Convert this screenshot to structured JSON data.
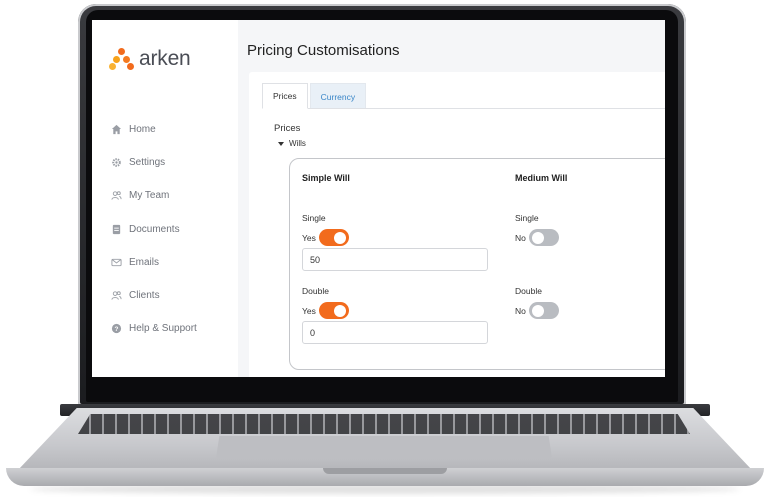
{
  "brand": {
    "name": "arken",
    "dot_colors": [
      "#f26b1d",
      "#f7a21b",
      "#f47a20",
      "#f9b233"
    ]
  },
  "sidebar": {
    "items": [
      {
        "label": "Home",
        "icon": "home-icon"
      },
      {
        "label": "Settings",
        "icon": "gear-icon"
      },
      {
        "label": "My Team",
        "icon": "team-icon"
      },
      {
        "label": "Documents",
        "icon": "document-icon"
      },
      {
        "label": "Emails",
        "icon": "mail-icon"
      },
      {
        "label": "Clients",
        "icon": "clients-icon"
      },
      {
        "label": "Help & Support",
        "icon": "help-icon"
      }
    ]
  },
  "main": {
    "title": "Pricing Customisations",
    "tabs": [
      {
        "label": "Prices",
        "active": true
      },
      {
        "label": "Currency",
        "active": false
      }
    ],
    "section_title": "Prices",
    "group_label": "Wills",
    "columns": [
      {
        "heading": "Simple Will",
        "single": {
          "label": "Single",
          "toggle_text": "Yes",
          "enabled": true,
          "value": "50"
        },
        "double": {
          "label": "Double",
          "toggle_text": "Yes",
          "enabled": true,
          "value": "0"
        }
      },
      {
        "heading": "Medium Will",
        "single": {
          "label": "Single",
          "toggle_text": "No",
          "enabled": false
        },
        "double": {
          "label": "Double",
          "toggle_text": "No",
          "enabled": false
        }
      }
    ]
  },
  "colors": {
    "accent": "#f26b1d",
    "tab_link": "#3a86c8",
    "toggle_off": "#b9bcc1"
  }
}
